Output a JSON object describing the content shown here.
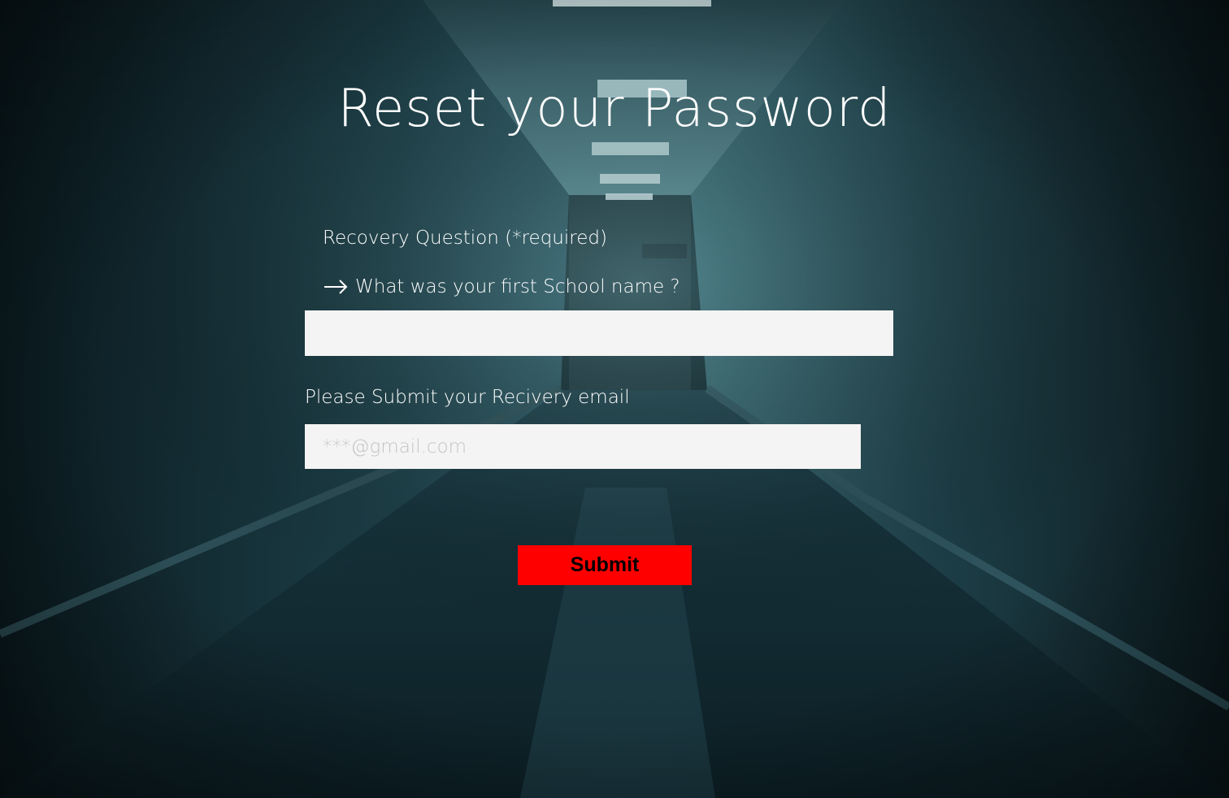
{
  "page": {
    "title": "Reset your Password"
  },
  "recovery": {
    "label": "Recovery Question (*required)",
    "question": "What was your first School name ?",
    "answer_value": ""
  },
  "email": {
    "label": "Please Submit your Recivery email",
    "placeholder": "***@gmail.com",
    "value": ""
  },
  "submit": {
    "label": "Submit"
  },
  "colors": {
    "submit_bg": "#ff0000",
    "field_bg": "#f4f4f4",
    "text": "#ffffff"
  },
  "icons": {
    "question_prefix": "arrow-right-icon"
  }
}
